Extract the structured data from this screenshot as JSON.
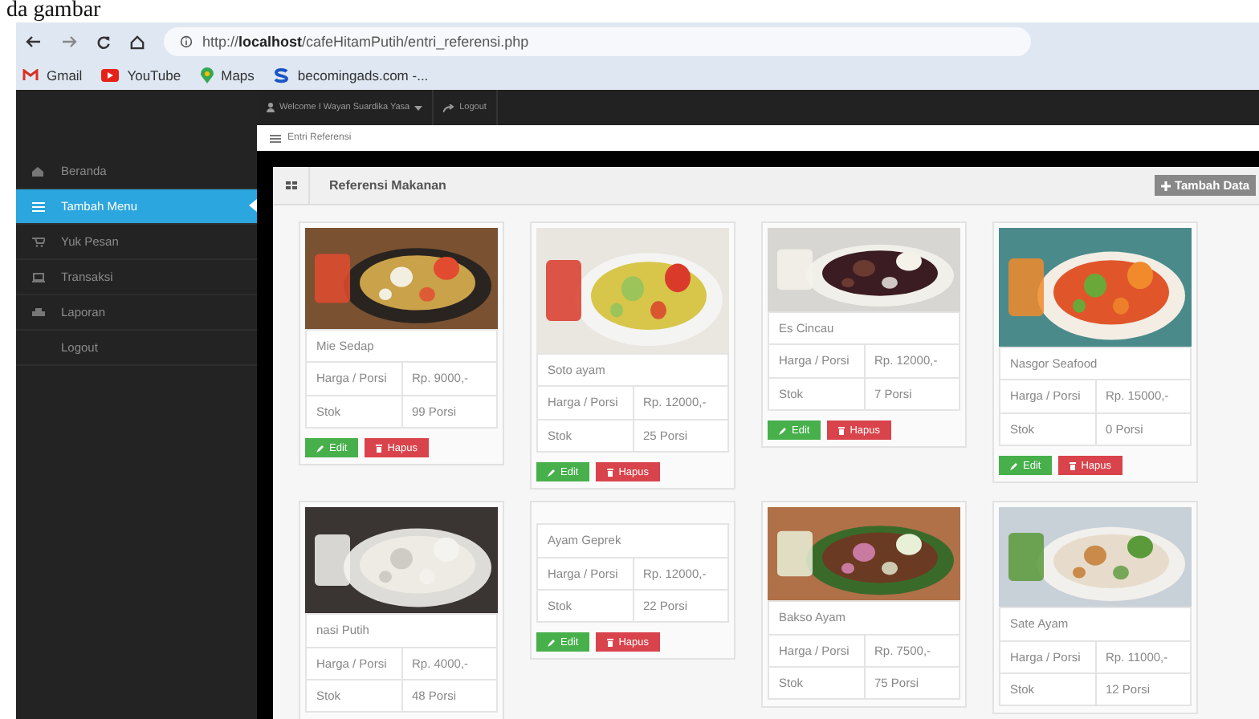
{
  "caption": "da gambar",
  "browser": {
    "url": "http://**localhost**/cafeHitamPutih/entri_referensi.php",
    "bookmarks": [
      {
        "label": "Gmail",
        "kind": "gmail"
      },
      {
        "label": "YouTube",
        "kind": "youtube"
      },
      {
        "label": "Maps",
        "kind": "maps"
      },
      {
        "label": "becomingads.com -...",
        "kind": "site"
      }
    ]
  },
  "navbar": {
    "user": "Welcome I Wayan Suardika Yasa",
    "logout": "Logout"
  },
  "breadcrumb": "Entri Referensi",
  "sidebar": {
    "items": [
      {
        "label": "Beranda",
        "kind": "home",
        "selected": false
      },
      {
        "label": "Tambah Menu",
        "kind": "list",
        "selected": true
      },
      {
        "label": "Yuk Pesan",
        "kind": "cart",
        "selected": false
      },
      {
        "label": "Transaksi",
        "kind": "laptop",
        "selected": false
      },
      {
        "label": "Laporan",
        "kind": "printer",
        "selected": false
      },
      {
        "label": "Logout",
        "kind": "plain",
        "selected": false
      }
    ]
  },
  "panel": {
    "title": "Referensi Makanan",
    "add_button": "Tambah Data",
    "cards": [
      {
        "name": "Mie Sedap",
        "price_label": "Harga / Porsi",
        "price": "Rp. 9000,-",
        "stock_label": "Stok",
        "stock": "99 Porsi",
        "buttons": [
          "Edit",
          "Hapus"
        ]
      },
      {
        "name": "Soto ayam",
        "price_label": "Harga / Porsi",
        "price": "Rp. 12000,-",
        "stock_label": "Stok",
        "stock": "25 Porsi",
        "buttons": [
          "Edit",
          "Hapus"
        ]
      },
      {
        "name": "Es Cincau",
        "price_label": "Harga / Porsi",
        "price": "Rp. 12000,-",
        "stock_label": "Stok",
        "stock": "7 Porsi",
        "buttons": [
          "Edit",
          "Hapus"
        ]
      },
      {
        "name": "Nasgor Seafood",
        "price_label": "Harga / Porsi",
        "price": "Rp. 15000,-",
        "stock_label": "Stok",
        "stock": "0 Porsi",
        "buttons": [
          "Edit",
          "Hapus"
        ]
      },
      {
        "name": "nasi Putih",
        "price_label": "Harga / Porsi",
        "price": "Rp. 4000,-",
        "stock_label": "Stok",
        "stock": "48 Porsi"
      },
      {
        "name": "Ayam Geprek",
        "price_label": "Harga / Porsi",
        "price": "Rp. 12000,-",
        "stock_label": "Stok",
        "stock": "22 Porsi",
        "buttons": [
          "Edit",
          "Hapus"
        ]
      },
      {
        "name": "Bakso Ayam",
        "price_label": "Harga / Porsi",
        "price": "Rp. 7500,-",
        "stock_label": "Stok",
        "stock": "75 Porsi"
      },
      {
        "name": "Sate Ayam",
        "price_label": "Harga / Porsi",
        "price": "Rp. 11000,-",
        "stock_label": "Stok",
        "stock": "12 Porsi"
      }
    ]
  }
}
